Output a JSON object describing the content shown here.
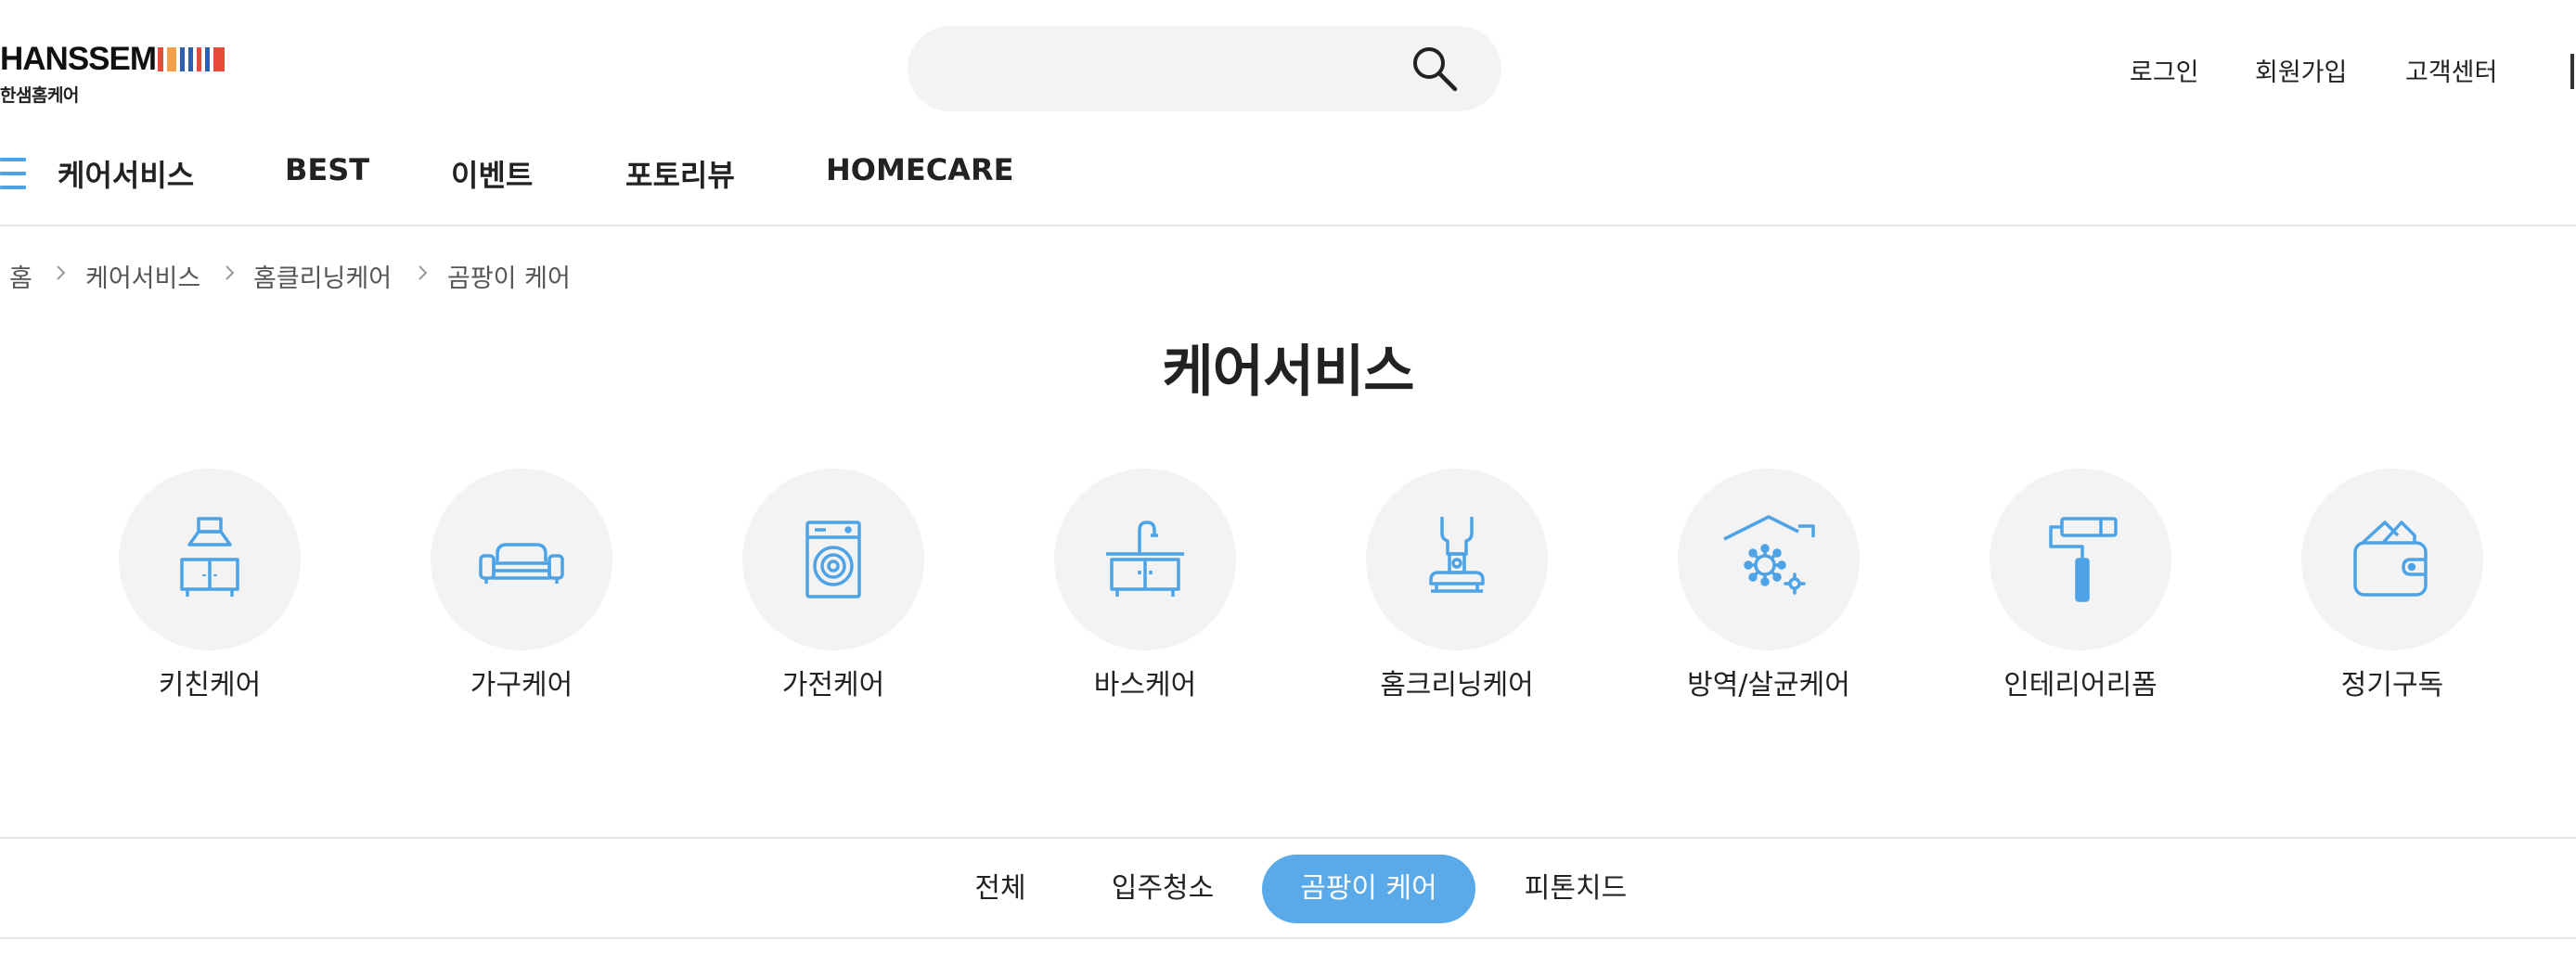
{
  "brand": {
    "logo_text": "HANSSEM",
    "logo_sub": "한샘홈케어",
    "stripe_colors": [
      "#e84a3a",
      "#f0a24b",
      "#2f5fb3",
      "#2f5fb3",
      "#e84a3a",
      "#2f5fb3",
      "#e84a3a"
    ]
  },
  "search": {
    "value": "",
    "placeholder": ""
  },
  "util_links": [
    "로그인",
    "회원가입",
    "고객센터"
  ],
  "nav": {
    "items": [
      "케어서비스",
      "BEST",
      "이벤트",
      "포토리뷰",
      "HOMECARE"
    ]
  },
  "breadcrumb": [
    "홈",
    "케어서비스",
    "홈클리닝케어",
    "곰팡이 케어"
  ],
  "page_title": "케어서비스",
  "categories": [
    {
      "label": "키친케어",
      "icon": "kitchen-hood-icon"
    },
    {
      "label": "가구케어",
      "icon": "sofa-icon"
    },
    {
      "label": "가전케어",
      "icon": "washing-machine-icon"
    },
    {
      "label": "바스케어",
      "icon": "bath-sink-icon"
    },
    {
      "label": "홈크리닝케어",
      "icon": "vacuum-cleaner-icon"
    },
    {
      "label": "방역/살균케어",
      "icon": "house-virus-icon"
    },
    {
      "label": "인테리어리폼",
      "icon": "paint-roller-icon"
    },
    {
      "label": "정기구독",
      "icon": "wallet-icon"
    }
  ],
  "tabs": [
    {
      "label": "전체",
      "active": false
    },
    {
      "label": "입주청소",
      "active": false
    },
    {
      "label": "곰팡이 케어",
      "active": true
    },
    {
      "label": "피톤치드",
      "active": false
    }
  ],
  "colors": {
    "accent": "#5aaaea",
    "icon_blue": "#4da3e6",
    "circle_bg": "#f3f3f3"
  }
}
